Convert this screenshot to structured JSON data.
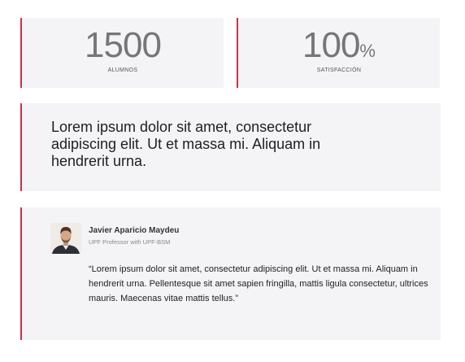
{
  "stats": [
    {
      "number": "1500",
      "unit": "",
      "label": "ALUMNOS"
    },
    {
      "number": "100",
      "unit": "%",
      "label": "SATISFACCIÓN"
    }
  ],
  "quote": {
    "text": "Lorem ipsum dolor sit amet, consectetur adipiscing elit. Ut et massa mi. Aliquam in hendrerit urna."
  },
  "testimonial": {
    "author_name": "Javier Aparicio Maydeu",
    "author_role": "UPF Professor with UPF-BSM",
    "text": "“Lorem ipsum dolor sit amet, consectetur adipiscing elit. Ut et massa mi. Aliquam in hendrerit urna. Pellentesque sit amet sapien fringilla, mattis ligula consectetur, ultrices mauris. Maecenas vitae mattis tellus.”"
  },
  "colors": {
    "accent": "#c8324a",
    "card_background": "#f4f4f6",
    "stat_number": "#767676"
  }
}
